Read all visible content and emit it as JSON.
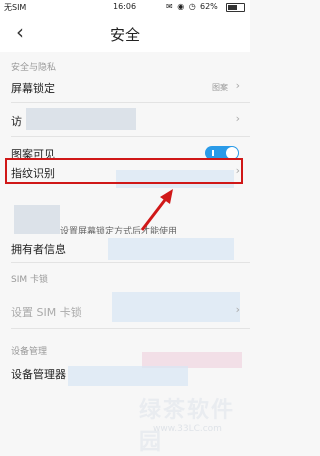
{
  "status_bar": {
    "carrier": "无SIM",
    "time": "16:06",
    "battery": "62%",
    "indicators": "✉ ◉ ◷"
  },
  "header": {
    "back_icon": "‹",
    "title": "安全"
  },
  "sections": {
    "privacy": "安全与隐私",
    "sim": "SIM 卡锁",
    "device": "设备管理"
  },
  "rows": {
    "screen_lock": {
      "label": "屏幕锁定",
      "value": "图案"
    },
    "visitor": {
      "label": "访"
    },
    "pattern_visible": {
      "label": "图案可见",
      "toggle_on": true
    },
    "fingerprint": {
      "label": "指纹识别"
    },
    "owner_info": {
      "label": "拥有者信息"
    },
    "sim_lock": {
      "label": "设置 SIM 卡锁"
    },
    "device_admin": {
      "label": "设备管理器"
    }
  },
  "hint": "设置屏幕锁定方式后才能使用",
  "chevron": "›",
  "watermark": {
    "text": "绿茶软件园",
    "url": "www.33LC.com"
  },
  "colors": {
    "toggle": "#2a9be8",
    "highlight": "#d01818"
  }
}
